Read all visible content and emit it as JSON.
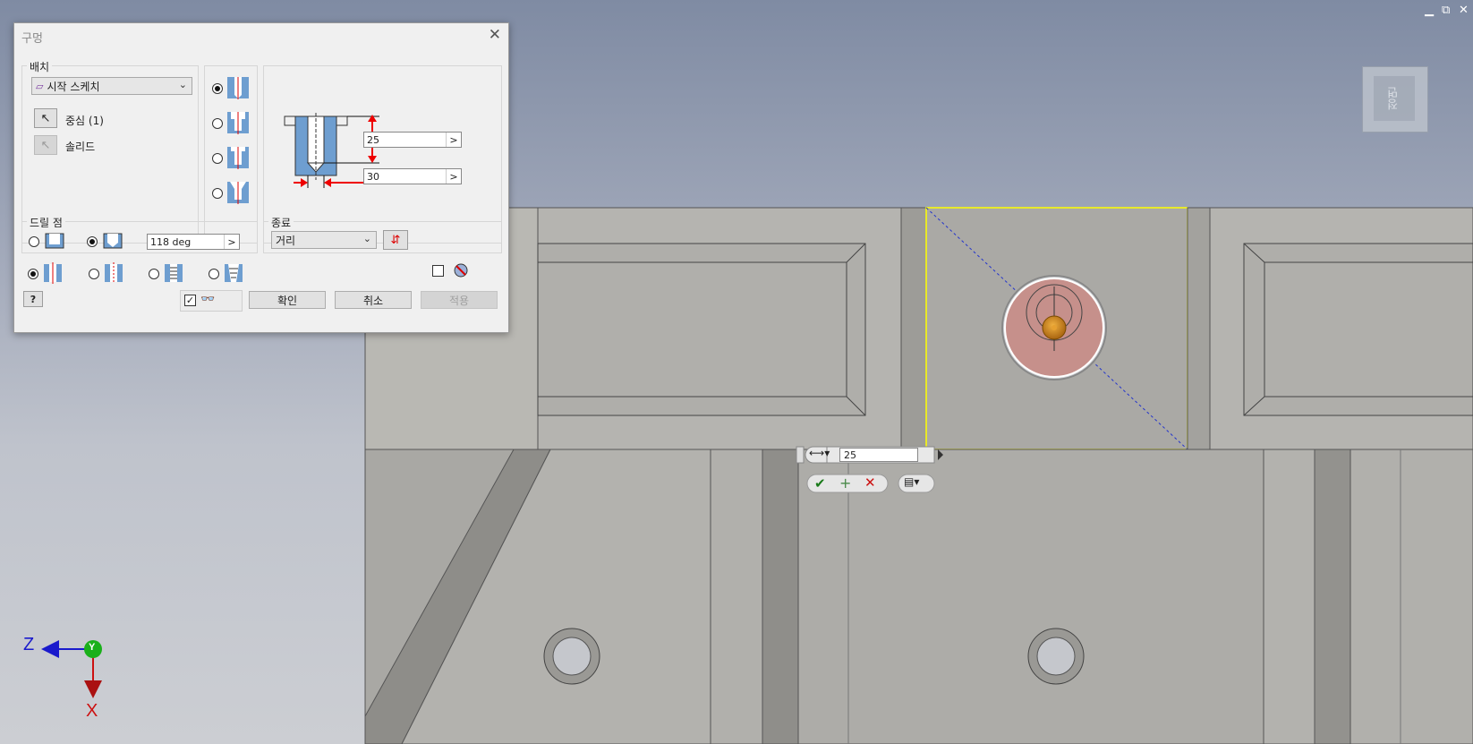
{
  "window_controls": {
    "minimize": "▁",
    "restore": "⧉",
    "close": "✕"
  },
  "viewcube": {
    "face_label": "정면"
  },
  "dialog": {
    "title": "구멍",
    "close_icon": "close-icon",
    "placement": {
      "group_label": "배치",
      "sketch_combo": "시작 스케치",
      "center_label": "중심 (1)",
      "solid_label": "솔리드"
    },
    "preview": {
      "depth_value": "25",
      "diameter_value": "30"
    },
    "drill_point": {
      "group_label": "드릴 점",
      "angle_value": "118 deg"
    },
    "termination": {
      "group_label": "종료",
      "combo_value": "거리"
    },
    "buttons": {
      "ok": "확인",
      "cancel": "취소",
      "apply": "적용"
    }
  },
  "mini_toolbar": {
    "value": "25"
  },
  "triad": {
    "z": "Z",
    "y": "Y",
    "x": "X"
  },
  "colors": {
    "accent": "#ff0000",
    "selection": "#ffff00",
    "hole_preview": "#c98d8a"
  }
}
